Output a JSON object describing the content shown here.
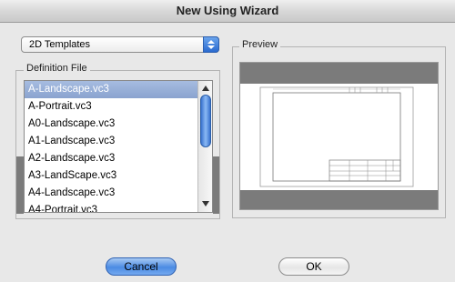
{
  "window": {
    "title": "New Using Wizard"
  },
  "template_type": {
    "selected": "2D Templates"
  },
  "definition_file": {
    "label": "Definition File",
    "files": [
      "A-Landscape.vc3",
      "A-Portrait.vc3",
      "A0-Landscape.vc3",
      "A1-Landscape.vc3",
      "A2-Landscape.vc3",
      "A3-LandScape.vc3",
      "A4-Landscape.vc3",
      "A4-Portrait.vc3"
    ],
    "selected_index": 0
  },
  "preview": {
    "label": "Preview"
  },
  "buttons": {
    "cancel": "Cancel",
    "ok": "OK"
  },
  "colors": {
    "selection": "#8aa3cf",
    "default_button": "#4b8be3",
    "preview_band": "#7b7b7b"
  }
}
